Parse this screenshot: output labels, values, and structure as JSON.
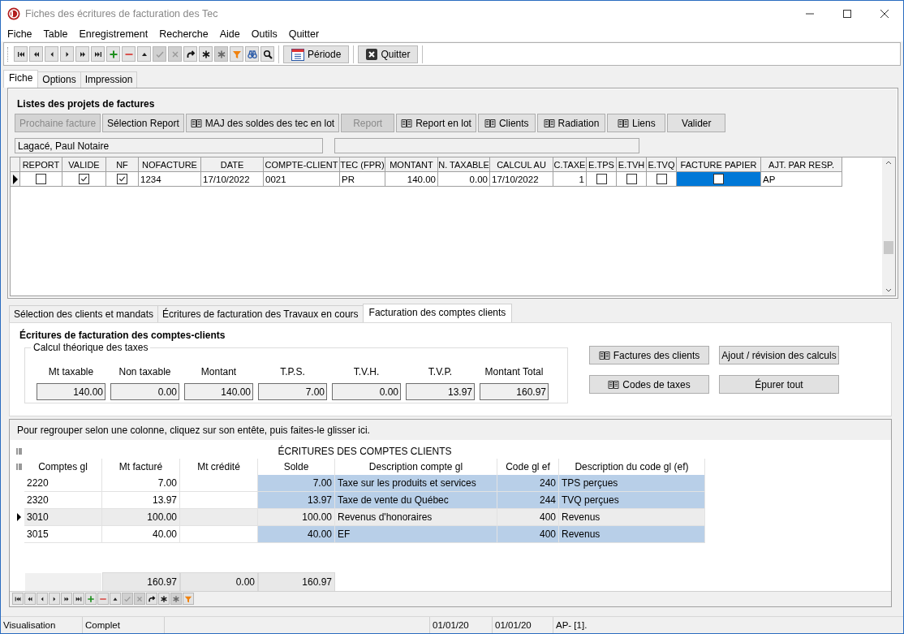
{
  "window": {
    "title": "Fiches des écritures de facturation des Tec"
  },
  "menu": [
    "Fiche",
    "Table",
    "Enregistrement",
    "Recherche",
    "Aide",
    "Outils",
    "Quitter"
  ],
  "toolbar": {
    "icons": [
      {
        "kind": "first",
        "disabled": false
      },
      {
        "kind": "prev-page",
        "disabled": false
      },
      {
        "kind": "prev",
        "disabled": false
      },
      {
        "kind": "next",
        "disabled": false
      },
      {
        "kind": "next-page",
        "disabled": false
      },
      {
        "kind": "last",
        "disabled": false
      },
      {
        "kind": "add",
        "disabled": false
      },
      {
        "kind": "remove",
        "disabled": false
      },
      {
        "kind": "up",
        "disabled": false
      },
      {
        "kind": "confirm",
        "disabled": true
      },
      {
        "kind": "cancel",
        "disabled": true
      },
      {
        "kind": "redo",
        "disabled": false
      },
      {
        "kind": "asterisk",
        "disabled": false
      },
      {
        "kind": "asterisk",
        "disabled": true
      },
      {
        "kind": "filter",
        "disabled": false
      },
      {
        "kind": "binoculars",
        "disabled": false
      },
      {
        "kind": "search",
        "disabled": false
      }
    ],
    "buttons": [
      {
        "label": "Période"
      },
      {
        "label": "Quitter"
      }
    ]
  },
  "tabs": [
    {
      "label": "Fiche",
      "selected": true
    },
    {
      "label": "Options",
      "selected": false
    },
    {
      "label": "Impression",
      "selected": false
    }
  ],
  "projects": {
    "title": "Listes des projets de factures",
    "buttons": [
      {
        "label": "Prochaine facture",
        "has_icon": false,
        "disabled": true
      },
      {
        "label": "Sélection Report",
        "has_icon": false,
        "disabled": false
      },
      {
        "label": "MAJ des soldes des tec en lot",
        "has_icon": true,
        "disabled": false
      },
      {
        "label": "Report",
        "has_icon": false,
        "disabled": true
      },
      {
        "label": "Report en lot",
        "has_icon": true,
        "disabled": false
      },
      {
        "label": "Clients",
        "has_icon": true,
        "disabled": false
      },
      {
        "label": "Radiation",
        "has_icon": true,
        "disabled": false
      },
      {
        "label": "Liens",
        "has_icon": true,
        "disabled": false
      },
      {
        "label": "Valider",
        "has_icon": false,
        "disabled": false
      }
    ],
    "client_field": {
      "value": "Lagacé, Paul Notaire"
    },
    "grid": {
      "columns": [
        "REPORT",
        "VALIDE",
        "NF",
        "NOFACTURE",
        "DATE",
        "COMPTE-CLIENT",
        "TEC (FPR)",
        "MONTANT",
        "N. TAXABLE",
        "CALCUL AU",
        "C.TAXE",
        "E.TPS",
        "E.TVH",
        "E.TVQ",
        "FACTURE PAPIER",
        "AJT. PAR RESP."
      ],
      "rows": [
        {
          "current": true,
          "cells": [
            {
              "kind": "check",
              "checked": false,
              "selected": false
            },
            {
              "kind": "check",
              "checked": true,
              "selected": false
            },
            {
              "kind": "check",
              "checked": true,
              "selected": false
            },
            {
              "kind": "text",
              "text": "1234",
              "selected": false
            },
            {
              "kind": "text",
              "text": "17/10/2022",
              "selected": false
            },
            {
              "kind": "text",
              "text": "0021",
              "selected": false
            },
            {
              "kind": "text",
              "text": "PR",
              "selected": false
            },
            {
              "kind": "number",
              "text": "140.00",
              "selected": false
            },
            {
              "kind": "number",
              "text": "0.00",
              "selected": false
            },
            {
              "kind": "text",
              "text": "17/10/2022",
              "selected": false
            },
            {
              "kind": "number",
              "text": "1",
              "selected": false
            },
            {
              "kind": "check",
              "checked": false,
              "selected": false
            },
            {
              "kind": "check",
              "checked": false,
              "selected": false
            },
            {
              "kind": "check",
              "checked": false,
              "selected": false
            },
            {
              "kind": "check",
              "checked": false,
              "selected": true
            },
            {
              "kind": "text",
              "text": "AP",
              "selected": false
            }
          ]
        }
      ]
    }
  },
  "lower_tabs": [
    {
      "label": "Sélection des clients et mandats",
      "selected": false
    },
    {
      "label": "Écritures de facturation des Travaux en cours",
      "selected": false
    },
    {
      "label": "Facturation des comptes clients",
      "selected": true
    }
  ],
  "billing": {
    "title": "Écritures de facturation des comptes-clients",
    "taxes": {
      "legend": "Calcul théorique des taxes",
      "fields": [
        {
          "label": "Mt taxable",
          "value": "140.00"
        },
        {
          "label": "Non taxable",
          "value": "0.00"
        },
        {
          "label": "Montant",
          "value": "140.00"
        },
        {
          "label": "T.P.S.",
          "value": "7.00"
        },
        {
          "label": "T.V.H.",
          "value": "0.00"
        },
        {
          "label": "T.V.P.",
          "value": "13.97"
        },
        {
          "label": "Montant Total",
          "value": "160.97"
        }
      ]
    },
    "buttons": [
      {
        "label": "Factures des clients",
        "has_icon": true
      },
      {
        "label": "Ajout / révision des calculs",
        "has_icon": false
      },
      {
        "label": "Codes de taxes",
        "has_icon": true
      },
      {
        "label": "Épurer tout",
        "has_icon": false
      }
    ]
  },
  "entries": {
    "group_hint": "Pour regrouper selon une colonne, cliquez sur son entête, puis faites-le glisser ici.",
    "title": "ÉCRITURES DES COMPTES CLIENTS",
    "columns": [
      {
        "label": "Comptes gl",
        "shaded": false
      },
      {
        "label": "Mt facturé",
        "shaded": false
      },
      {
        "label": "Mt crédité",
        "shaded": false
      },
      {
        "label": "Solde",
        "shaded": true
      },
      {
        "label": "Description compte gl",
        "shaded": true
      },
      {
        "label": "Code gl ef",
        "shaded": true
      },
      {
        "label": "Description du code gl (ef)",
        "shaded": true
      }
    ],
    "rows": [
      {
        "current": false,
        "cells": [
          "2220",
          "7.00",
          "",
          "7.00",
          "Taxe sur les produits et services",
          "240",
          "TPS perçues"
        ]
      },
      {
        "current": false,
        "cells": [
          "2320",
          "13.97",
          "",
          "13.97",
          "Taxe de vente du Québec",
          "244",
          "TVQ perçues"
        ]
      },
      {
        "current": true,
        "cells": [
          "3010",
          "100.00",
          "",
          "100.00",
          "Revenus d'honoraires",
          "400",
          "Revenus"
        ]
      },
      {
        "current": false,
        "cells": [
          "3015",
          "40.00",
          "",
          "40.00",
          "EF",
          "400",
          "Revenus"
        ]
      }
    ],
    "totals": [
      "160.97",
      "0.00",
      "160.97"
    ],
    "navigator": [
      {
        "kind": "first",
        "disabled": false
      },
      {
        "kind": "prev-page",
        "disabled": false
      },
      {
        "kind": "prev",
        "disabled": false
      },
      {
        "kind": "next",
        "disabled": false
      },
      {
        "kind": "next-page",
        "disabled": false
      },
      {
        "kind": "last",
        "disabled": false
      },
      {
        "kind": "add",
        "disabled": false
      },
      {
        "kind": "remove",
        "disabled": false
      },
      {
        "kind": "up",
        "disabled": false
      },
      {
        "kind": "confirm",
        "disabled": true
      },
      {
        "kind": "cancel",
        "disabled": true
      },
      {
        "kind": "redo",
        "disabled": false
      },
      {
        "kind": "asterisk",
        "disabled": false
      },
      {
        "kind": "asterisk",
        "disabled": true
      },
      {
        "kind": "filter",
        "disabled": false
      }
    ]
  },
  "status_bar": [
    "Visualisation",
    "Complet",
    "01/01/20",
    "01/01/20",
    "AP- [1]."
  ]
}
